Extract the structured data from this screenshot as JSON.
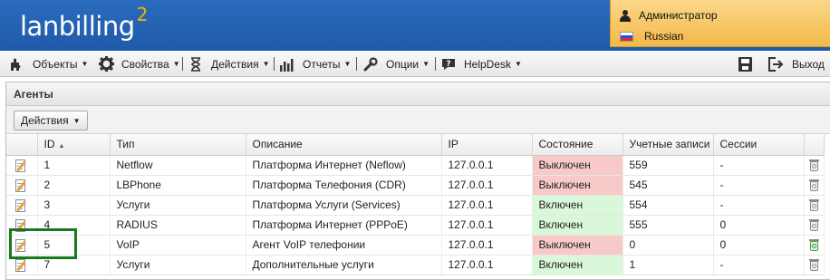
{
  "header": {
    "logo_text": "lanbilling",
    "logo_sup": "2",
    "user_name": "Администратор",
    "language": "Russian"
  },
  "menu": {
    "items": [
      {
        "label": "Объекты",
        "icon": "puzzle-icon"
      },
      {
        "label": "Свойства",
        "icon": "gear-icon"
      },
      {
        "label": "Действия",
        "icon": "hourglass-icon"
      },
      {
        "label": "Отчеты",
        "icon": "bar-chart-icon"
      },
      {
        "label": "Опции",
        "icon": "wrench-icon"
      },
      {
        "label": "HelpDesk",
        "icon": "help-chat-icon"
      }
    ],
    "exit_label": "Выход",
    "save_icon": "floppy-icon",
    "exit_icon": "exit-icon"
  },
  "panel": {
    "title": "Агенты",
    "actions_label": "Действия"
  },
  "table": {
    "columns": [
      "ID",
      "Тип",
      "Описание",
      "IP",
      "Состояние",
      "Учетные записи",
      "Сессии"
    ],
    "sort_column": "ID",
    "rows": [
      {
        "id": "1",
        "type": "Netflow",
        "desc": "Платформа Интернет (Neflow)",
        "ip": "127.0.0.1",
        "state": "Выключен",
        "accounts": "559",
        "sessions": "-"
      },
      {
        "id": "2",
        "type": "LBPhone",
        "desc": "Платформа Телефония (CDR)",
        "ip": "127.0.0.1",
        "state": "Выключен",
        "accounts": "545",
        "sessions": "-"
      },
      {
        "id": "3",
        "type": "Услуги",
        "desc": "Платформа Услуги (Services)",
        "ip": "127.0.0.1",
        "state": "Включен",
        "accounts": "554",
        "sessions": "-"
      },
      {
        "id": "4",
        "type": "RADIUS",
        "desc": "Платформа Интернет (PPPoE)",
        "ip": "127.0.0.1",
        "state": "Включен",
        "accounts": "555",
        "sessions": "0"
      },
      {
        "id": "5",
        "type": "VoIP",
        "desc": "Агент VoIP телефонии",
        "ip": "127.0.0.1",
        "state": "Выключен",
        "accounts": "0",
        "sessions": "0"
      },
      {
        "id": "7",
        "type": "Услуги",
        "desc": "Дополнительные услуги",
        "ip": "127.0.0.1",
        "state": "Включен",
        "accounts": "1",
        "sessions": "-"
      }
    ],
    "state_colors": {
      "off": "#f7c9c9",
      "on": "#d9f7d9"
    }
  }
}
